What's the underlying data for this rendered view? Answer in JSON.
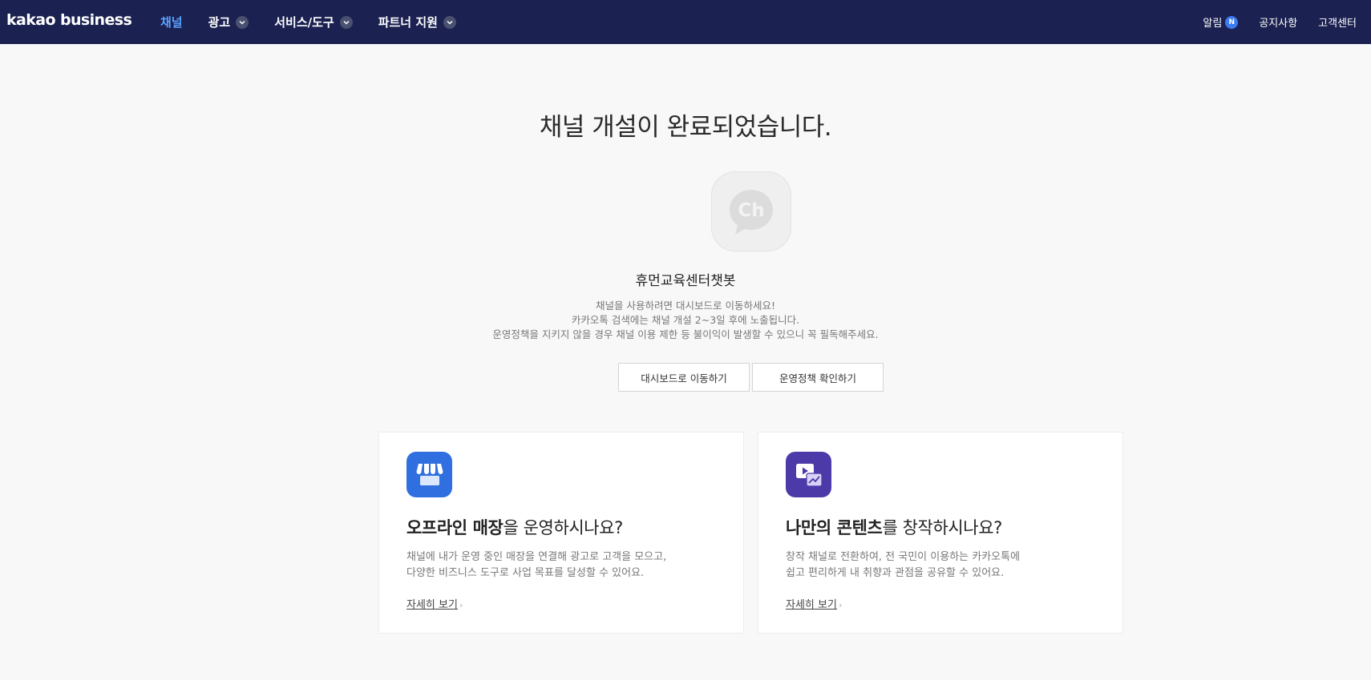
{
  "header": {
    "logo": "kakao business",
    "nav": [
      {
        "label": "채널",
        "active": true,
        "dropdown": false
      },
      {
        "label": "광고",
        "active": false,
        "dropdown": true
      },
      {
        "label": "서비스/도구",
        "active": false,
        "dropdown": true
      },
      {
        "label": "파트너 지원",
        "active": false,
        "dropdown": true
      }
    ],
    "util": {
      "alarm": "알림",
      "alarm_badge": "N",
      "notice": "공지사항",
      "support": "고객센터"
    }
  },
  "main": {
    "title": "채널 개설이 완료되었습니다.",
    "profile_icon": "Ch",
    "channel_name": "휴먼교육센터챗봇",
    "desc": [
      "채널을 사용하려면 대시보드로 이동하세요!",
      "카카오톡 검색에는 채널 개설 2~3일 후에 노출됩니다.",
      "운영정책을 지키지 않을 경우 채널 이용 제한 등 불이익이 발생할 수 있으니 꼭 필독해주세요."
    ],
    "buttons": {
      "dashboard": "대시보드로 이동하기",
      "policy": "운영정책 확인하기"
    }
  },
  "cards": [
    {
      "icon": "store-icon",
      "icon_color": "#2f6fe0",
      "title_bold": "오프라인 매장",
      "title_rest": "을 운영하시나요?",
      "desc": [
        "채널에 내가 운영 중인 매장을 연결해 광고로 고객을 모으고,",
        "다양한 비즈니스 도구로 사업 목표를 달성할 수 있어요."
      ],
      "link": "자세히 보기"
    },
    {
      "icon": "content-media-icon",
      "icon_color": "#4b3aa8",
      "title_bold": "나만의 콘텐츠",
      "title_rest": "를 창작하시나요?",
      "desc": [
        "창작 채널로 전환하여, 전 국민이 이용하는 카카오톡에",
        "쉽고 편리하게 내 취향과 관점을 공유할 수 있어요."
      ],
      "link": "자세히 보기"
    }
  ]
}
